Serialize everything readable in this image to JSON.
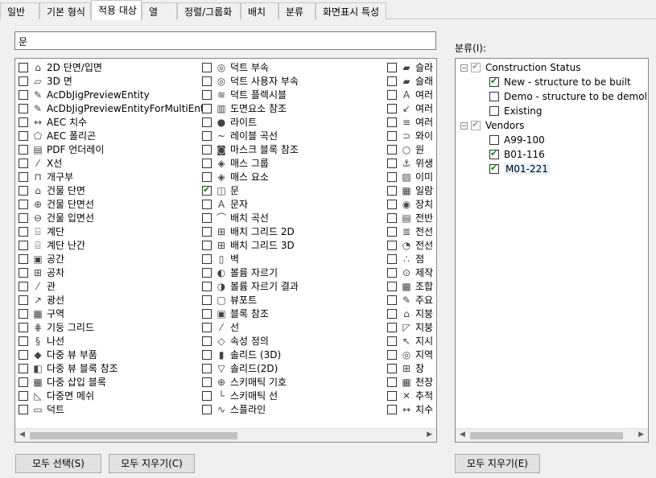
{
  "tabs": [
    "일반",
    "기본 형식",
    "적용 대상",
    "열",
    "정렬/그룹화",
    "배치",
    "분류",
    "화면표시 특성"
  ],
  "active_tab": 2,
  "search": {
    "value": "문"
  },
  "objects": {
    "col1": [
      {
        "label": "2D 단면/입면",
        "icon": "building-icon",
        "checked": false
      },
      {
        "label": "3D 면",
        "icon": "face-icon",
        "checked": false
      },
      {
        "label": "AcDbJigPreviewEntity",
        "icon": "brush-icon",
        "checked": false
      },
      {
        "label": "AcDbJigPreviewEntityForMultiEnts",
        "icon": "brush-icon",
        "checked": false
      },
      {
        "label": "AEC 치수",
        "icon": "dimension-icon",
        "checked": false
      },
      {
        "label": "AEC 폴리곤",
        "icon": "polygon-icon",
        "checked": false
      },
      {
        "label": "PDF 언더레이",
        "icon": "pdf-icon",
        "checked": false
      },
      {
        "label": "X선",
        "icon": "xline-icon",
        "checked": false
      },
      {
        "label": "개구부",
        "icon": "opening-icon",
        "checked": false
      },
      {
        "label": "건물 단면",
        "icon": "building-section-icon",
        "checked": false
      },
      {
        "label": "건물 단면선",
        "icon": "section-line-icon",
        "checked": false
      },
      {
        "label": "건물 입면선",
        "icon": "elevation-line-icon",
        "checked": false
      },
      {
        "label": "계단",
        "icon": "stair-icon",
        "checked": false
      },
      {
        "label": "계단 난간",
        "icon": "railing-icon",
        "checked": false
      },
      {
        "label": "공간",
        "icon": "space-icon",
        "checked": false
      },
      {
        "label": "공차",
        "icon": "tolerance-icon",
        "checked": false
      },
      {
        "label": "관",
        "icon": "pipe-icon",
        "checked": false
      },
      {
        "label": "광선",
        "icon": "ray-icon",
        "checked": false
      },
      {
        "label": "구역",
        "icon": "zone-icon",
        "checked": false
      },
      {
        "label": "기둥 그리드",
        "icon": "column-grid-icon",
        "checked": false
      },
      {
        "label": "나선",
        "icon": "helix-icon",
        "checked": false
      },
      {
        "label": "다중 뷰 부품",
        "icon": "mv-part-icon",
        "checked": false
      },
      {
        "label": "다중 뷰 블록 참조",
        "icon": "mv-block-icon",
        "checked": false
      },
      {
        "label": "다중 삽입 블록",
        "icon": "minsert-icon",
        "checked": false
      },
      {
        "label": "다중면 메쉬",
        "icon": "mesh-icon",
        "checked": false
      },
      {
        "label": "덕트",
        "icon": "duct-icon",
        "checked": false
      }
    ],
    "col2": [
      {
        "label": "덕트 부속",
        "icon": "duct-fitting-icon",
        "checked": false
      },
      {
        "label": "덕트 사용자 부속",
        "icon": "duct-custom-icon",
        "checked": false
      },
      {
        "label": "덕트 플렉시블",
        "icon": "flex-duct-icon",
        "checked": false
      },
      {
        "label": "도면요소 참조",
        "icon": "reference-icon",
        "checked": false
      },
      {
        "label": "라이트",
        "icon": "light-icon",
        "checked": false
      },
      {
        "label": "레이블 곡선",
        "icon": "label-curve-icon",
        "checked": false
      },
      {
        "label": "마스크 블록 참조",
        "icon": "mask-icon",
        "checked": false
      },
      {
        "label": "매스 그룹",
        "icon": "mass-group-icon",
        "checked": false
      },
      {
        "label": "매스 요소",
        "icon": "mass-element-icon",
        "checked": false
      },
      {
        "label": "문",
        "icon": "door-icon",
        "checked": true
      },
      {
        "label": "문자",
        "icon": "text-icon",
        "checked": false
      },
      {
        "label": "배치 곡선",
        "icon": "layout-curve-icon",
        "checked": false
      },
      {
        "label": "배치 그리드 2D",
        "icon": "grid2d-icon",
        "checked": false
      },
      {
        "label": "배치 그리드 3D",
        "icon": "grid3d-icon",
        "checked": false
      },
      {
        "label": "벽",
        "icon": "wall-icon",
        "checked": false
      },
      {
        "label": "볼륨 자르기",
        "icon": "slice-icon",
        "checked": false
      },
      {
        "label": "볼륨 자르기 결과",
        "icon": "slice-result-icon",
        "checked": false
      },
      {
        "label": "뷰포트",
        "icon": "viewport-icon",
        "checked": false
      },
      {
        "label": "블록 참조",
        "icon": "block-icon",
        "checked": false
      },
      {
        "label": "선",
        "icon": "line-icon",
        "checked": false
      },
      {
        "label": "속성 정의",
        "icon": "attribute-icon",
        "checked": false
      },
      {
        "label": "솔리드 (3D)",
        "icon": "solid3d-icon",
        "checked": false
      },
      {
        "label": "솔리드(2D)",
        "icon": "solid2d-icon",
        "checked": false
      },
      {
        "label": "스키매틱 기호",
        "icon": "schematic-symbol-icon",
        "checked": false
      },
      {
        "label": "스키매틱 선",
        "icon": "schematic-line-icon",
        "checked": false
      },
      {
        "label": "스플라인",
        "icon": "spline-icon",
        "checked": false
      }
    ],
    "col3": [
      {
        "label": "슬라",
        "icon": "slab-icon",
        "checked": false
      },
      {
        "label": "슬래",
        "icon": "slab-edge-icon",
        "checked": false
      },
      {
        "label": "여러",
        "icon": "mtext-icon",
        "checked": false
      },
      {
        "label": "여러",
        "icon": "mleader-icon",
        "checked": false
      },
      {
        "label": "여러",
        "icon": "mline-icon",
        "checked": false
      },
      {
        "label": "와이",
        "icon": "wipeout-icon",
        "checked": false
      },
      {
        "label": "원",
        "icon": "circle-icon",
        "checked": false
      },
      {
        "label": "위생",
        "icon": "plumbing-icon",
        "checked": false
      },
      {
        "label": "이미",
        "icon": "image-icon",
        "checked": false
      },
      {
        "label": "일람",
        "icon": "schedule-icon",
        "checked": false
      },
      {
        "label": "장치",
        "icon": "device-icon",
        "checked": false
      },
      {
        "label": "전반",
        "icon": "panel-icon",
        "checked": false
      },
      {
        "label": "전선",
        "icon": "wire-icon",
        "checked": false
      },
      {
        "label": "전선",
        "icon": "wire-fitting-icon",
        "checked": false
      },
      {
        "label": "점",
        "icon": "point-icon",
        "checked": false
      },
      {
        "label": "제작",
        "icon": "fabrication-icon",
        "checked": false
      },
      {
        "label": "조합",
        "icon": "assembly-icon",
        "checked": false
      },
      {
        "label": "주요",
        "icon": "main-icon",
        "checked": false
      },
      {
        "label": "지붕",
        "icon": "roof-icon",
        "checked": false
      },
      {
        "label": "지붕",
        "icon": "roof-slab-icon",
        "checked": false
      },
      {
        "label": "지시",
        "icon": "leader-icon",
        "checked": false
      },
      {
        "label": "지역",
        "icon": "region-icon",
        "checked": false
      },
      {
        "label": "창",
        "icon": "window-icon",
        "checked": false
      },
      {
        "label": "천장",
        "icon": "ceiling-icon",
        "checked": false
      },
      {
        "label": "추적",
        "icon": "trace-icon",
        "checked": false
      },
      {
        "label": "치수",
        "icon": "dim-icon",
        "checked": false
      }
    ]
  },
  "classification": {
    "label": "분류(I):",
    "nodes": [
      {
        "label": "Construction Status",
        "level": 0,
        "expander": "−",
        "checked": true,
        "grey": true
      },
      {
        "label": "New - structure to be built",
        "level": 1,
        "checked": true,
        "grey": false
      },
      {
        "label": "Demo - structure to be demolish",
        "level": 1,
        "checked": false,
        "grey": false
      },
      {
        "label": "Existing",
        "level": 1,
        "checked": false,
        "grey": false
      },
      {
        "label": "Vendors",
        "level": 0,
        "expander": "−",
        "checked": true,
        "grey": true
      },
      {
        "label": "A99-100",
        "level": 1,
        "checked": false,
        "grey": false
      },
      {
        "label": "B01-116",
        "level": 1,
        "checked": true,
        "grey": false
      },
      {
        "label": "M01-221",
        "level": 1,
        "checked": true,
        "grey": false,
        "selected": true
      }
    ]
  },
  "buttons": {
    "select_all": "모두 선택(S)",
    "clear_all": "모두 지우기(C)",
    "clear_all_class": "모두 지우기(E)"
  },
  "scroll": {
    "left": "◀",
    "right": "▶"
  }
}
